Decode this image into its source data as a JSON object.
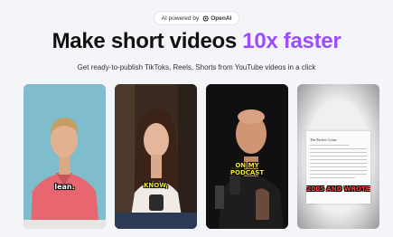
{
  "badge": {
    "prefix": "AI powered by",
    "brand": "OpenAI"
  },
  "headline": {
    "main": "Make short videos ",
    "accent": "10x faster"
  },
  "subtitle": "Get ready-to-publish TikToks, Reels, Shorts from YouTube videos in a click",
  "cards": [
    {
      "caption": "lean."
    },
    {
      "caption": "KNOW,"
    },
    {
      "caption_line1": "ON MY",
      "caption_line2": "PODCAST"
    },
    {
      "doc_title": "The Perfect Crime",
      "caption": "2005 AND WROTE"
    }
  ],
  "colors": {
    "accent": "#9b4dff",
    "background": "#f4f5f9"
  }
}
